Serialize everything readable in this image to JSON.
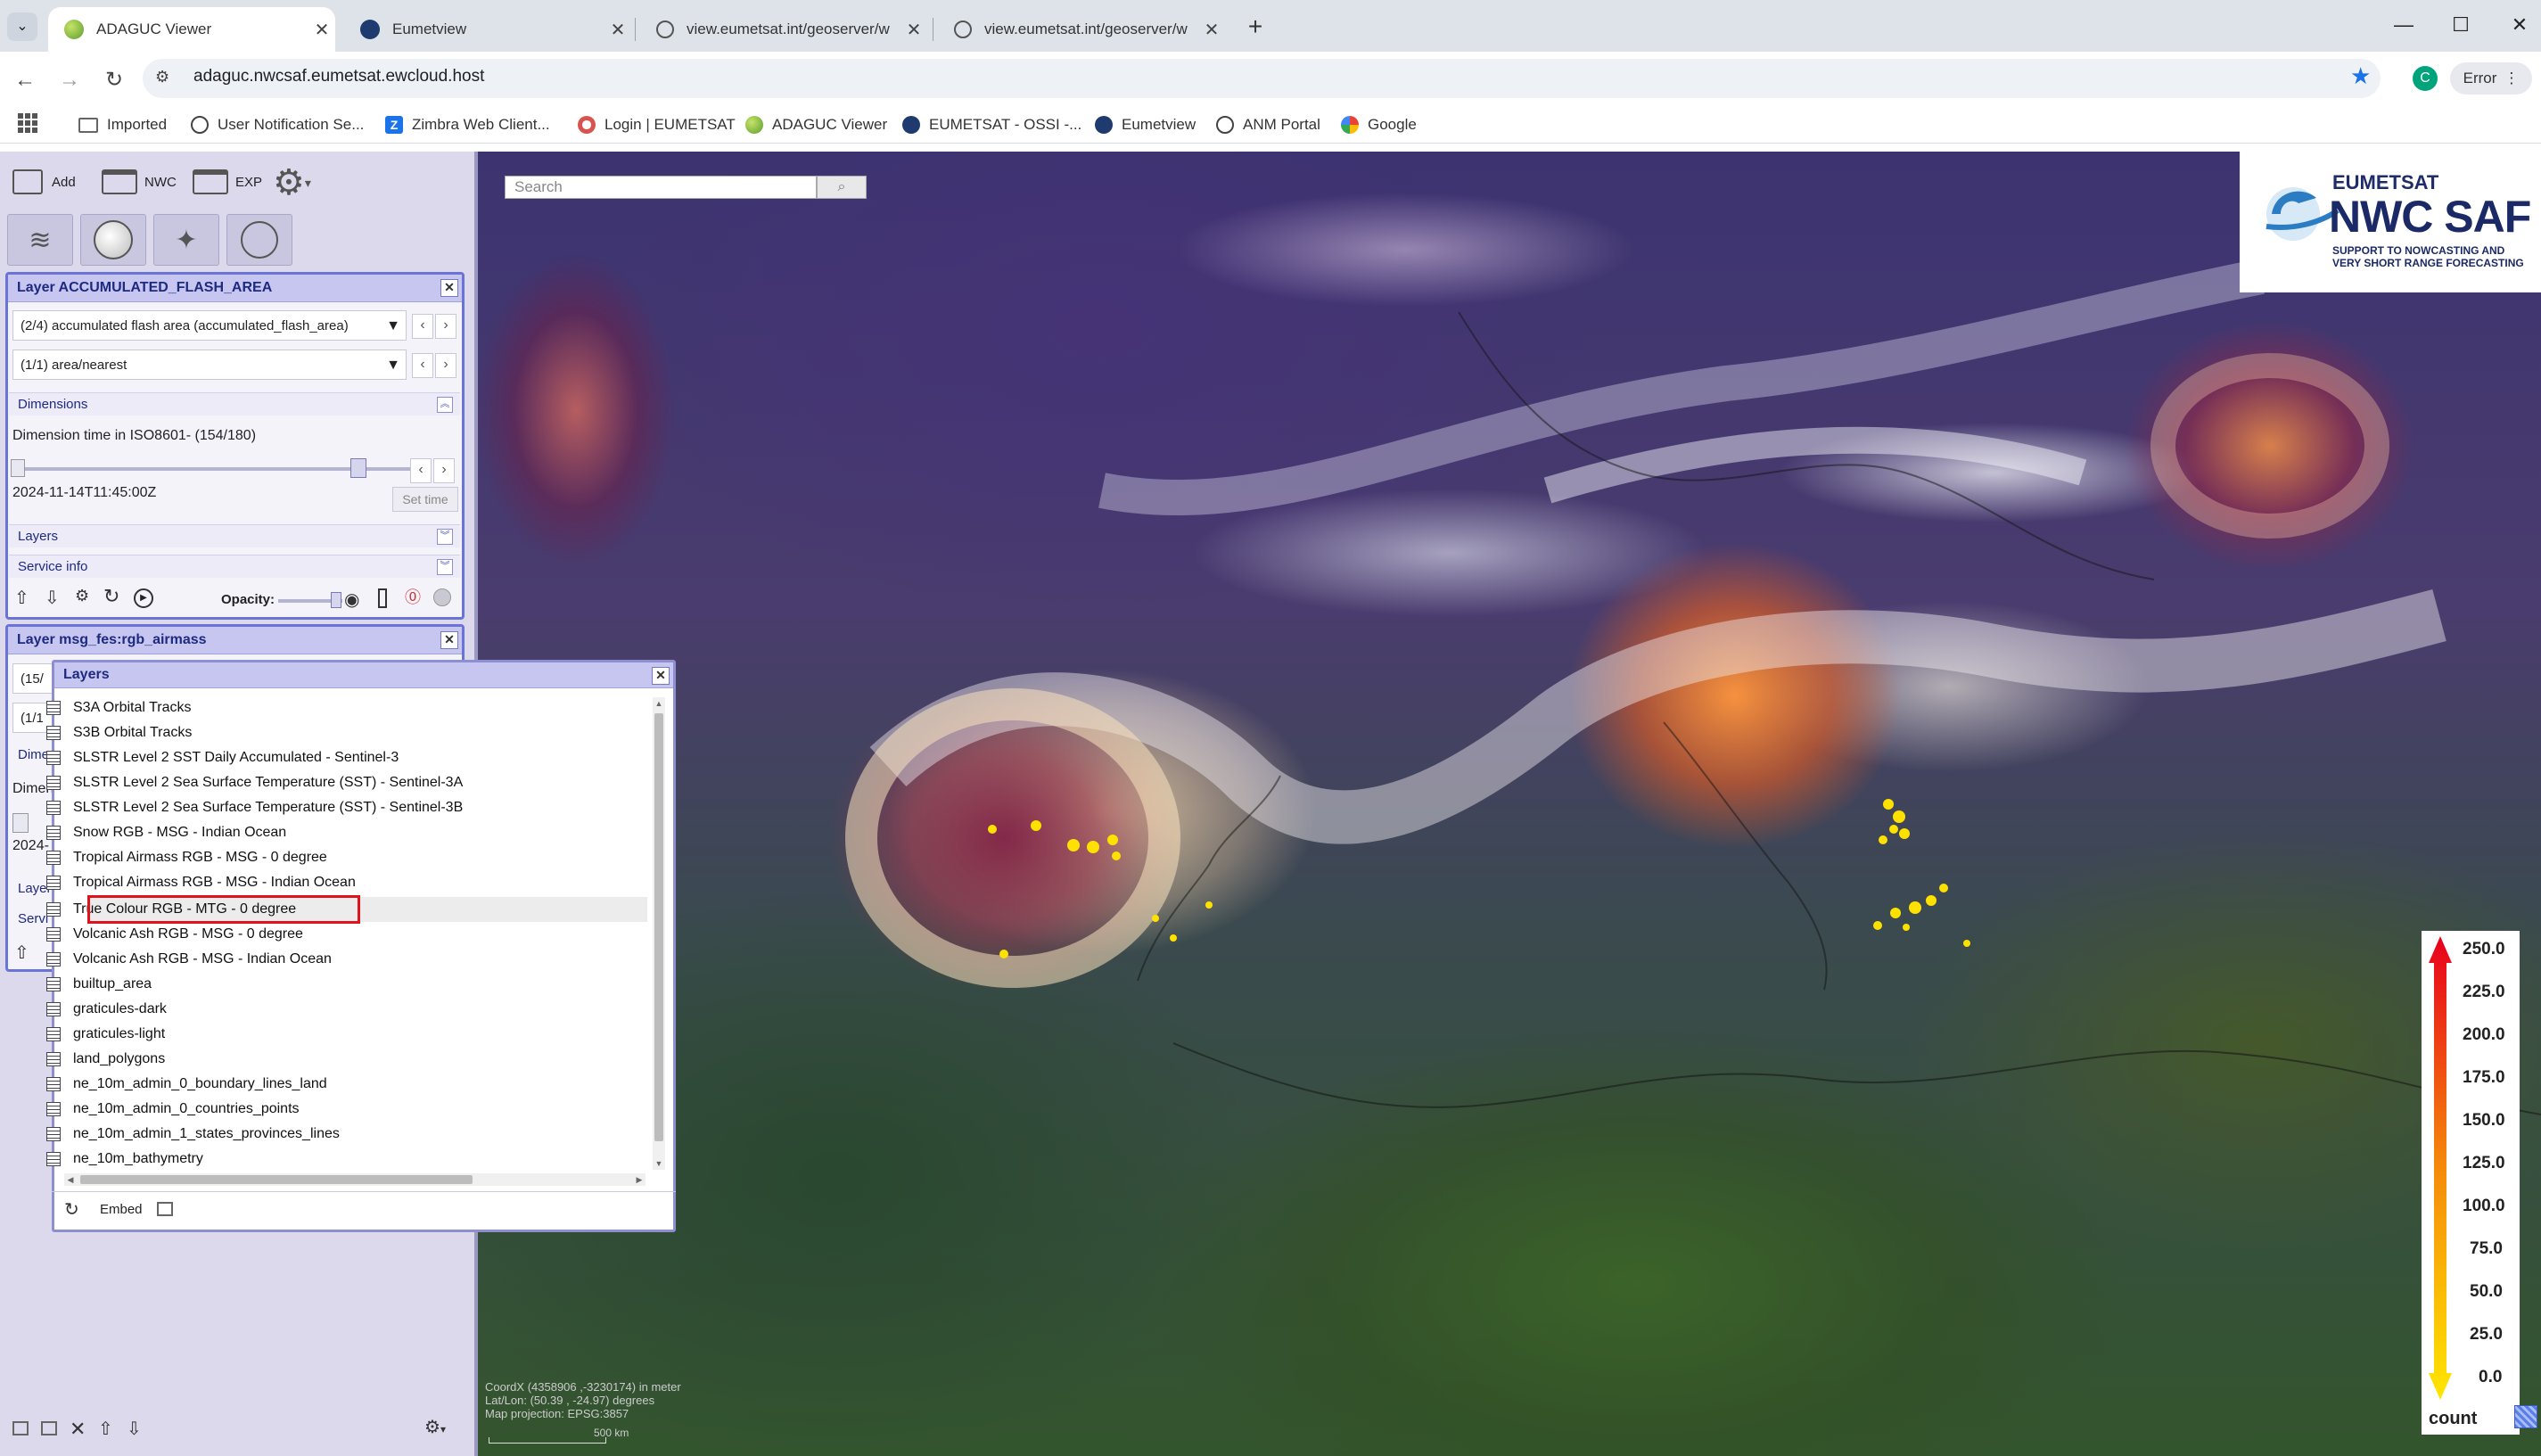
{
  "browser": {
    "tabs": [
      {
        "title": "ADAGUC Viewer",
        "active": true,
        "icon": "adaguc-favicon",
        "color": "#7cb342"
      },
      {
        "title": "Eumetview",
        "active": false,
        "icon": "eumetsat-favicon",
        "color": "#1f3a6e"
      },
      {
        "title": "view.eumetsat.int/geoserver/w",
        "active": false,
        "icon": "globe-favicon",
        "color": "#555555"
      },
      {
        "title": "view.eumetsat.int/geoserver/w",
        "active": false,
        "icon": "globe-favicon",
        "color": "#555555"
      }
    ],
    "new_tab": "+",
    "url": "adaguc.nwcsaf.eumetsat.ewcloud.host",
    "profile_initial": "C",
    "error_label": "Error",
    "bookmarks": [
      {
        "label": "Imported",
        "icon": "folder-icon",
        "color": "#666666"
      },
      {
        "label": "User Notification Se...",
        "icon": "globe-favicon",
        "color": "#444444"
      },
      {
        "label": "Zimbra Web Client...",
        "icon": "zimbra-favicon",
        "color": "#1a73e8"
      },
      {
        "label": "Login | EUMETSAT",
        "icon": "eumetsat-favicon",
        "color": "#d9534f"
      },
      {
        "label": "ADAGUC Viewer",
        "icon": "adaguc-favicon",
        "color": "#7cb342"
      },
      {
        "label": "EUMETSAT - OSSI -...",
        "icon": "eumetsat-favicon",
        "color": "#1f3a6e"
      },
      {
        "label": "Eumetview",
        "icon": "eumetsat-favicon",
        "color": "#1f3a6e"
      },
      {
        "label": "ANM Portal",
        "icon": "globe-favicon",
        "color": "#444444"
      },
      {
        "label": "Google",
        "icon": "google-favicon",
        "color": "#4285f4"
      }
    ]
  },
  "toolbar": {
    "add_label": "Add",
    "nwc_label": "NWC",
    "exp_label": "EXP"
  },
  "layer1": {
    "title": "Layer ACCUMULATED_FLASH_AREA",
    "style_select": "(2/4) accumulated flash area (accumulated_flash_area)",
    "render_select": "(1/1) area/nearest",
    "dimensions_label": "Dimensions",
    "dimension_time_label": "Dimension time in ISO8601- (154/180)",
    "time_value": "2024-11-14T11:45:00Z",
    "time_slider_position": 0.85,
    "set_time_label": "Set time",
    "layers_label": "Layers",
    "service_info_label": "Service info",
    "opacity_label": "Opacity:",
    "opacity_value": 0.9
  },
  "layer2": {
    "title": "Layer msg_fes:rgb_airmass",
    "style_select": "(15/",
    "render_select": "(1/1",
    "dimensions_label": "Dime",
    "dimension_label": "Dimen",
    "time_value": "2024-",
    "layers_label": "Layer",
    "service_label": "Servi"
  },
  "search": {
    "placeholder": "Search"
  },
  "layers_dialog": {
    "title": "Layers",
    "items": [
      "S3A Orbital Tracks",
      "S3B Orbital Tracks",
      "SLSTR Level 2 SST Daily Accumulated - Sentinel-3",
      "SLSTR Level 2 Sea Surface Temperature (SST) - Sentinel-3A",
      "SLSTR Level 2 Sea Surface Temperature (SST) - Sentinel-3B",
      "Snow RGB - MSG - Indian Ocean",
      "Tropical Airmass RGB - MSG - 0 degree",
      "Tropical Airmass RGB - MSG - Indian Ocean",
      "True Colour RGB - MTG - 0 degree",
      "Volcanic Ash RGB - MSG - 0 degree",
      "Volcanic Ash RGB - MSG - Indian Ocean",
      "builtup_area",
      "graticules-dark",
      "graticules-light",
      "land_polygons",
      "ne_10m_admin_0_boundary_lines_land",
      "ne_10m_admin_0_countries_points",
      "ne_10m_admin_1_states_provinces_lines",
      "ne_10m_bathymetry"
    ],
    "highlighted_item": "True Colour RGB - MTG - 0 degree",
    "embed_label": "Embed"
  },
  "logo": {
    "org": "EUMETSAT",
    "name": "NWC SAF",
    "tagline_1": "SUPPORT TO NOWCASTING AND",
    "tagline_2": "VERY SHORT RANGE FORECASTING"
  },
  "legend": {
    "ticks": [
      "250.0",
      "225.0",
      "200.0",
      "175.0",
      "150.0",
      "125.0",
      "100.0",
      "75.0",
      "50.0",
      "25.0",
      "0.0"
    ],
    "unit": "count",
    "colors": {
      "top": "#e8001c",
      "mid": "#f58a0a",
      "bottom": "#ffe600"
    }
  },
  "map_info": {
    "coords_line1": "CoordX (4358906 ,-3230174) in meter",
    "coords_line2": "Lat/Lon: (50.39 , -24.97) degrees",
    "coords_line3": "Map projection: EPSG:3857",
    "scale_label": "500 km"
  }
}
